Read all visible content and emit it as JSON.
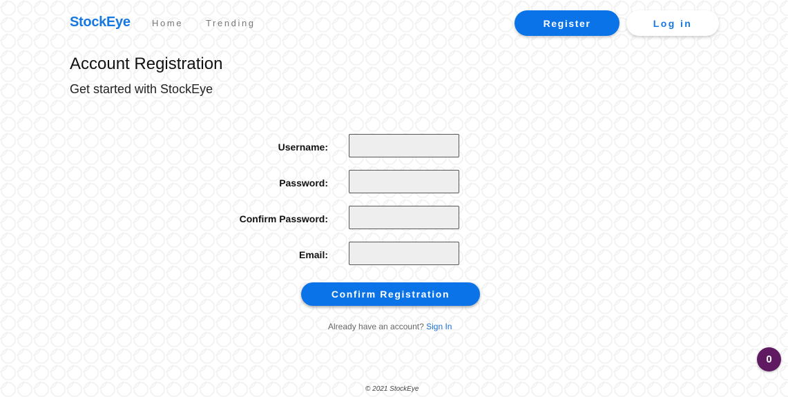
{
  "nav": {
    "brand": "StockEye",
    "links": [
      "Home",
      "Trending"
    ],
    "register_label": "Register",
    "login_label": "Log in"
  },
  "page": {
    "title": "Account Registration",
    "subtitle": "Get started with StockEye"
  },
  "form": {
    "fields": [
      {
        "label": "Username:",
        "value": ""
      },
      {
        "label": "Password:",
        "value": ""
      },
      {
        "label": "Confirm Password:",
        "value": ""
      },
      {
        "label": "Email:",
        "value": ""
      }
    ],
    "submit_label": "Confirm Registration"
  },
  "signin": {
    "prompt": "Already have an account?",
    "link": "Sign In"
  },
  "footer": {
    "text": "© 2021 StockEye"
  },
  "badge": {
    "count": "0"
  },
  "colors": {
    "brand": "#1577e0",
    "primary_button": "#0a73e8",
    "badge": "#5f1a62"
  }
}
